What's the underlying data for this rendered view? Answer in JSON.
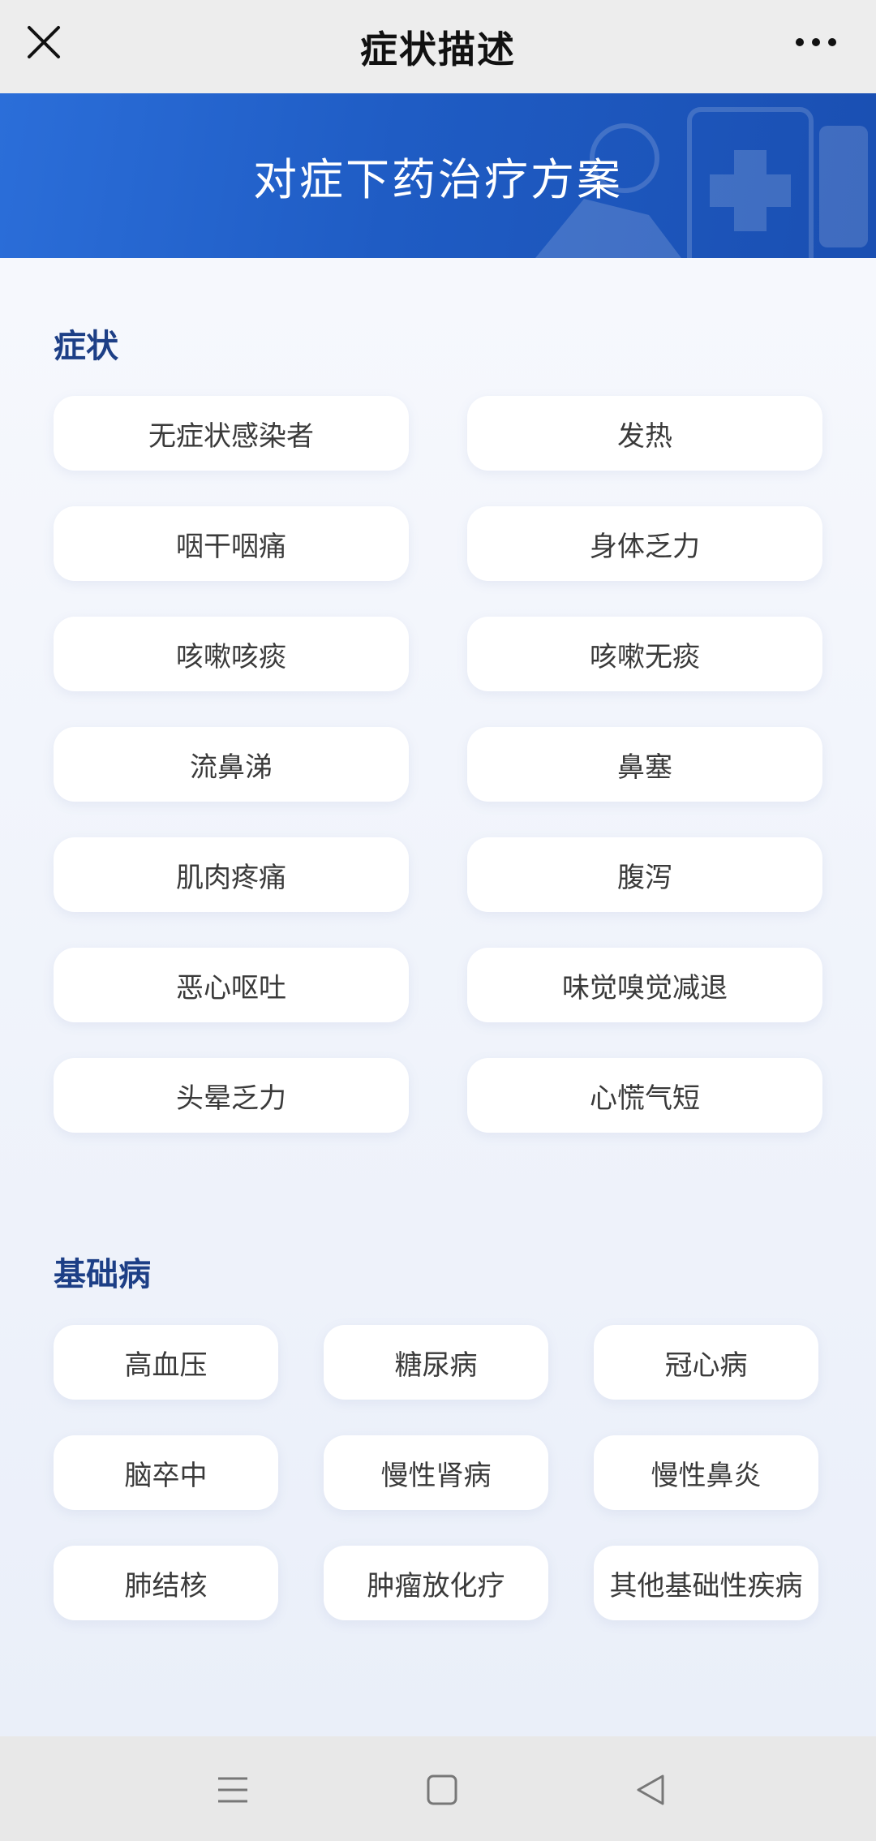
{
  "header": {
    "title": "症状描述",
    "close_icon": "close-icon",
    "more_icon": "more-icon"
  },
  "banner": {
    "title": "对症下药治疗方案",
    "colors": {
      "start": "#2b6ed9",
      "end": "#1a4fb2"
    }
  },
  "symptoms": {
    "title": "症状",
    "items": [
      "无症状感染者",
      "发热",
      "咽干咽痛",
      "身体乏力",
      "咳嗽咳痰",
      "咳嗽无痰",
      "流鼻涕",
      "鼻塞",
      "肌肉疼痛",
      "腹泻",
      "恶心呕吐",
      "味觉嗅觉减退",
      "头晕乏力",
      "心慌气短"
    ]
  },
  "diseases": {
    "title": "基础病",
    "items": [
      "高血压",
      "糖尿病",
      "冠心病",
      "脑卒中",
      "慢性肾病",
      "慢性鼻炎",
      "肺结核",
      "肿瘤放化疗",
      "其他基础性疾病"
    ]
  },
  "nav": {
    "icons": [
      "menu-icon",
      "home-square-icon",
      "back-triangle-icon"
    ]
  },
  "colors": {
    "section_title": "#1d3f86",
    "chip_text": "#3a3a3a"
  }
}
